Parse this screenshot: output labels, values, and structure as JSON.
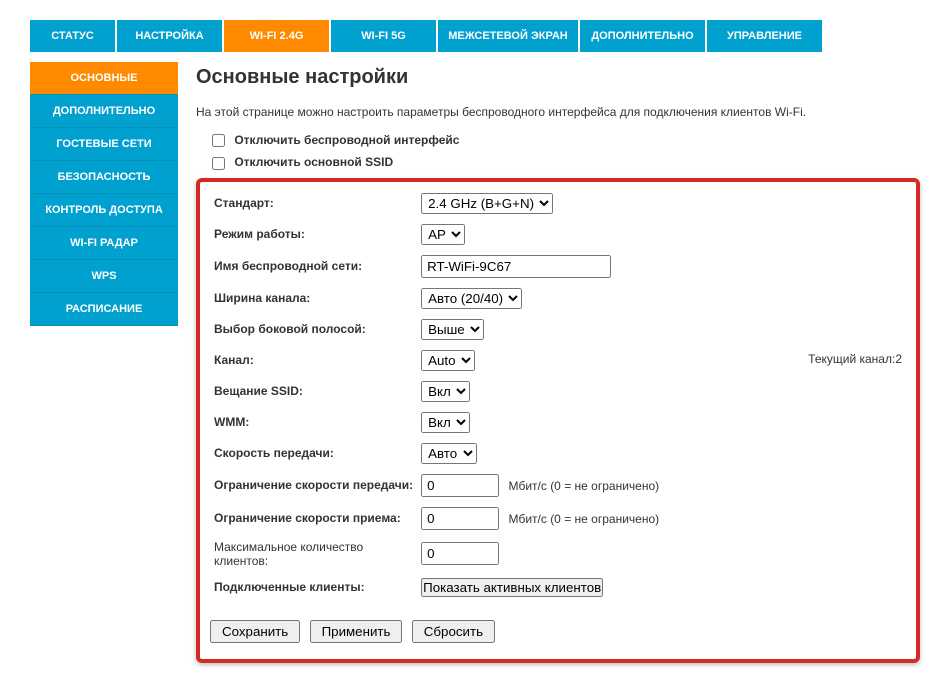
{
  "topnav": {
    "items": [
      {
        "label": "СТАТУС"
      },
      {
        "label": "НАСТРОЙКА"
      },
      {
        "label": "WI-FI 2.4G",
        "active": true
      },
      {
        "label": "WI-FI 5G"
      },
      {
        "label": "МЕЖСЕТЕВОЙ ЭКРАН"
      },
      {
        "label": "ДОПОЛНИТЕЛЬНО"
      },
      {
        "label": "УПРАВЛЕНИЕ"
      }
    ]
  },
  "side": {
    "items": [
      {
        "label": "ОСНОВНЫЕ",
        "active": true
      },
      {
        "label": "ДОПОЛНИТЕЛЬНО"
      },
      {
        "label": "ГОСТЕВЫЕ СЕТИ"
      },
      {
        "label": "БЕЗОПАСНОСТЬ"
      },
      {
        "label": "КОНТРОЛЬ ДОСТУПА"
      },
      {
        "label": "WI-FI РАДАР"
      },
      {
        "label": "WPS"
      },
      {
        "label": "РАСПИСАНИЕ"
      }
    ]
  },
  "page": {
    "title": "Основные настройки",
    "intro": "На этой странице можно настроить параметры беспроводного интерфейса для подключения клиентов Wi-Fi.",
    "cb_disable_wlan": "Отключить беспроводной интерфейс",
    "cb_disable_ssid": "Отключить основной SSID"
  },
  "form": {
    "standard": {
      "label": "Стандарт:",
      "value": "2.4 GHz (B+G+N)"
    },
    "mode": {
      "label": "Режим работы:",
      "value": "AP"
    },
    "ssid": {
      "label": "Имя беспроводной сети:",
      "value": "RT-WiFi-9C67"
    },
    "chwidth": {
      "label": "Ширина канала:",
      "value": "Авто (20/40)"
    },
    "sideband": {
      "label": "Выбор боковой полосой:",
      "value": "Выше"
    },
    "channel": {
      "label": "Канал:",
      "value": "Auto",
      "cur_label": "Текущий канал:",
      "cur_value": "2"
    },
    "bcast": {
      "label": "Вещание SSID:",
      "value": "Вкл"
    },
    "wmm": {
      "label": "WMM:",
      "value": "Вкл"
    },
    "rate": {
      "label": "Скорость передачи:",
      "value": "Авто"
    },
    "txlimit": {
      "label": "Ограничение скорости передачи:",
      "value": "0",
      "unit": "Мбит/с (0 = не ограничено)"
    },
    "rxlimit": {
      "label": "Ограничение скорости приема:",
      "value": "0",
      "unit": "Мбит/с (0 = не ограничено)"
    },
    "maxcli": {
      "label": "Максимальное количество клиентов:",
      "value": "0"
    },
    "clients": {
      "label": "Подключенные клиенты:",
      "btn": "Показать активных клиентов"
    }
  },
  "actions": {
    "save": "Сохранить",
    "apply": "Применить",
    "reset": "Сбросить"
  }
}
